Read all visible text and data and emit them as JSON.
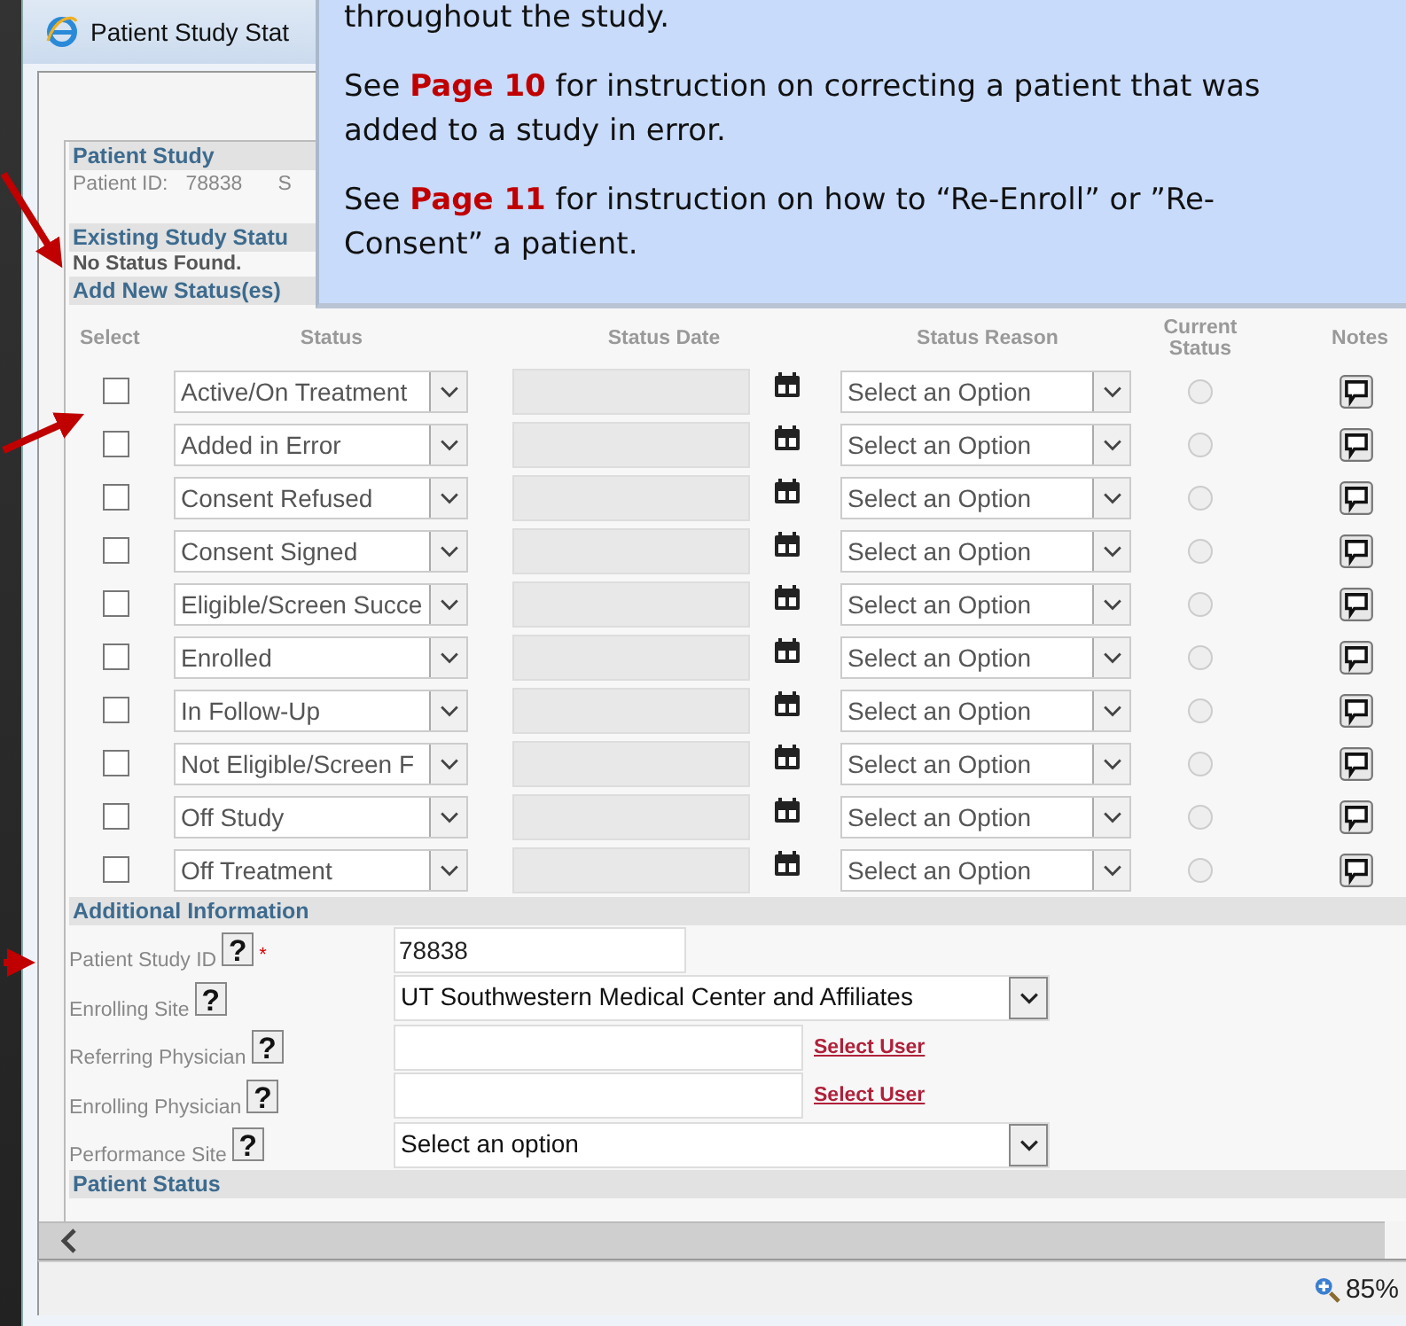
{
  "window": {
    "title": "Patient Study Stat"
  },
  "callout": {
    "paragraphs": [
      "throughout the study.",
      "See **Page 10** for instruction on correcting a patient that was added to a study in error.",
      "See **Page 11** for instruction on how to “Re-Enroll” or ”Re-Consent” a patient."
    ]
  },
  "patient_study": {
    "heading": "Patient Study",
    "patient_id_label": "Patient ID:",
    "patient_id": "78838",
    "column_2": "S"
  },
  "existing_status": {
    "heading": "Existing Study Statu",
    "message": "No Status Found."
  },
  "add_status": {
    "heading": "Add New Status(es)",
    "columns": [
      "Select",
      "Status",
      "Status Date",
      "Status Reason",
      "Current Status",
      "Notes"
    ],
    "rows": [
      {
        "checked": false,
        "status": "Active/On Treatment",
        "reason": "Select an Option",
        "current": false
      },
      {
        "checked": false,
        "status": "Added in Error",
        "reason": "Select an Option",
        "current": false
      },
      {
        "checked": false,
        "status": "Consent Refused",
        "reason": "Select an Option",
        "current": false
      },
      {
        "checked": false,
        "status": "Consent Signed",
        "reason": "Select an Option",
        "current": false
      },
      {
        "checked": false,
        "status": "Eligible/Screen Succe",
        "reason": "Select an Option",
        "current": false
      },
      {
        "checked": false,
        "status": "Enrolled",
        "reason": "Select an Option",
        "current": false
      },
      {
        "checked": false,
        "status": "In Follow-Up",
        "reason": "Select an Option",
        "current": false
      },
      {
        "checked": false,
        "status": "Not Eligible/Screen F",
        "reason": "Select an Option",
        "current": false
      },
      {
        "checked": false,
        "status": "Off Study",
        "reason": "Select an Option",
        "current": false
      },
      {
        "checked": false,
        "status": "Off Treatment",
        "reason": "Select an Option",
        "current": false
      }
    ]
  },
  "additional_info": {
    "heading": "Additional Information",
    "fields": [
      {
        "kind": "text",
        "label": "Patient Study ID",
        "help": "?",
        "required_mark": "*",
        "value": "78838"
      },
      {
        "kind": "select",
        "label": "Enrolling Site",
        "help": "?",
        "value": "UT Southwestern Medical Center and Affiliates"
      },
      {
        "kind": "user",
        "label": "Referring Physician",
        "help": "?",
        "link": "Select User"
      },
      {
        "kind": "user",
        "label": "Enrolling Physician",
        "help": "?",
        "link": "Select User"
      },
      {
        "kind": "select",
        "label": "Performance Site",
        "help": "?",
        "value": "Select an option"
      }
    ]
  },
  "patient_status": {
    "heading": "Patient Status"
  },
  "status_bar": {
    "zoom": "85%"
  }
}
